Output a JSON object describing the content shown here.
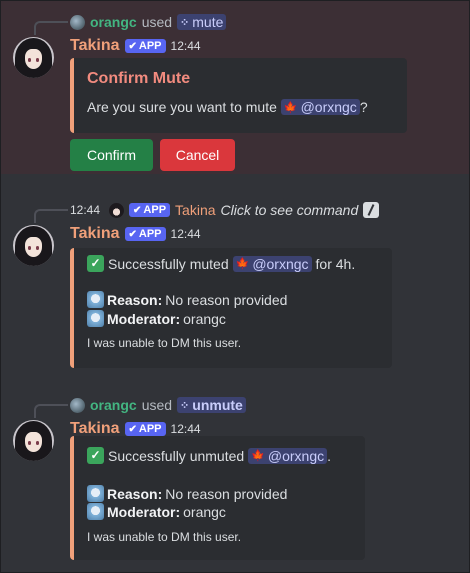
{
  "messages": [
    {
      "reference": {
        "user": "orangc",
        "used": "used",
        "command": "mute"
      },
      "author": "Takina",
      "app_tag": "APP",
      "time": "12:44",
      "embed": {
        "title": "Confirm Mute",
        "desc_prefix": "Are you sure you want to mute",
        "mention": "@orxngc",
        "desc_suffix": "?"
      },
      "buttons": {
        "confirm": "Confirm",
        "cancel": "Cancel"
      }
    },
    {
      "reference": {
        "time": "12:44",
        "app_tag": "APP",
        "author": "Takina",
        "hint": "Click to see command"
      },
      "author": "Takina",
      "app_tag": "APP",
      "time": "12:44",
      "embed": {
        "line_prefix": "Successfully muted",
        "mention": "@orxngc",
        "line_suffix": "for 4h.",
        "reason_label": "Reason:",
        "reason_value": "No reason provided",
        "moderator_label": "Moderator:",
        "moderator_value": "orangc",
        "note": "I was unable to DM this user."
      }
    },
    {
      "reference": {
        "user": "orangc",
        "used": "used",
        "command": "unmute"
      },
      "author": "Takina",
      "app_tag": "APP",
      "time": "12:44",
      "embed": {
        "line_prefix": "Successfully unmuted",
        "mention": "@orxngc",
        "line_suffix": ".",
        "reason_label": "Reason:",
        "reason_value": "No reason provided",
        "moderator_label": "Moderator:",
        "moderator_value": "orangc",
        "note": "I was unable to DM this user."
      }
    }
  ],
  "icons": {
    "check": "✔",
    "leaf": "🍁",
    "slash": "/",
    "success": "✓"
  },
  "colors": {
    "background": "#313338",
    "highlight": "#3c2f35",
    "embed_bg": "#2b2d31",
    "embed_border": "#f0a07a",
    "username": "#f0a07a",
    "app_tag": "#5865f2",
    "confirm": "#248046",
    "cancel": "#da373c",
    "mention_bg": "#3c4270",
    "ref_user": "#43b581"
  }
}
